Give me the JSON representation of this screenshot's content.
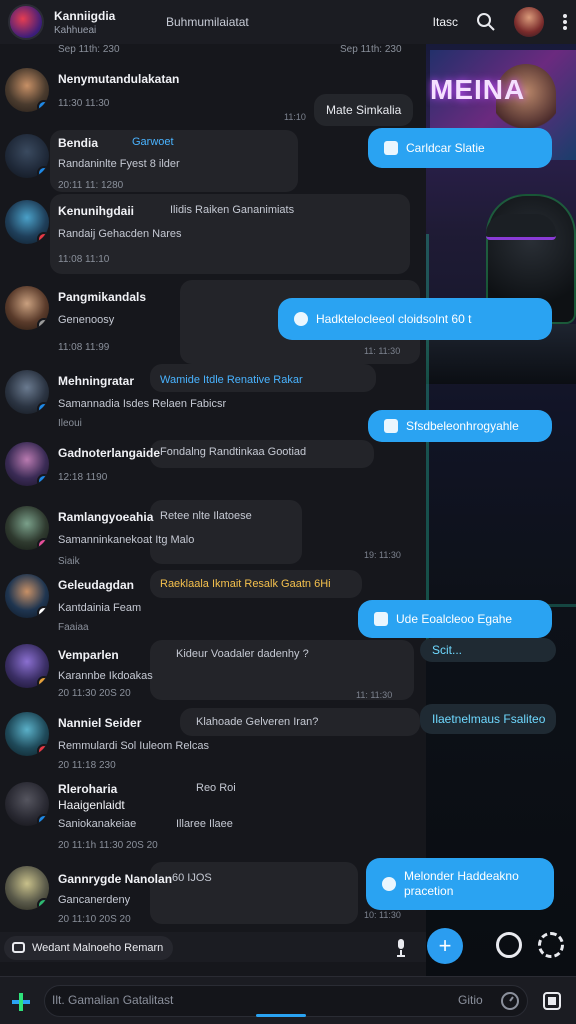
{
  "header": {
    "title": "Kanniigdia",
    "subtitle": "Kahhueai",
    "center": "Buhmumilaiatat",
    "right_label": "Itasc"
  },
  "chat": {
    "top_time_left": "Sep 11th: 230",
    "top_time_right": "Sep 11th: 230",
    "items": [
      {
        "name": "Nenymutandulakatan",
        "line": "",
        "meta": "11:30 11:30",
        "avatar_color": "#4a3b2e",
        "badge": "#1e88e5"
      },
      {
        "name": "Bendia",
        "line": "Randaninlte Fyest  8 ilder",
        "meta": "20:11 11: 1280",
        "avatar_color": "#202a3a",
        "badge": "#1e88e5"
      },
      {
        "name": "Kenunihgdaii",
        "line": "Randaij Gehacden  Nares",
        "meta": "11:08 11:10",
        "avatar_color": "#1f3f5a",
        "badge": "#e53945"
      },
      {
        "name": "Pangmikandals",
        "line": "Genenoosy",
        "meta": "11:08 11:99",
        "avatar_color": "#5a3b2b",
        "badge": "#9b9b9b"
      },
      {
        "name": "Mehningratar",
        "line": "Samannadia Isdes  Relaen  Fabicsr",
        "meta": "Ileoui",
        "avatar_color": "#2b3442",
        "badge": "#1e88e5"
      },
      {
        "name": "Gadnoterlangaide",
        "line": "",
        "meta": "12:18 1190",
        "avatar_color": "#3a2b55",
        "badge": "#1e88e5"
      },
      {
        "name": "Ramlangyoeahia",
        "line": "Samanninkanekoat  Itg  Malo",
        "meta": "Siaik",
        "avatar_color": "#2f3a2f",
        "badge": "#e54f9a"
      },
      {
        "name": "Geleudagdan",
        "line": "Kantdainia Feam",
        "meta": "Faaiaa",
        "avatar_color": "#1f3550",
        "badge": "#ffffff"
      },
      {
        "name": "Vemparlen",
        "line": "Karannbe Ikdoakas",
        "meta": "20 11:30 20S 20",
        "avatar_color": "#3b2f66",
        "badge": "#e5a03a"
      },
      {
        "name": "Nanniel  Seider",
        "line": "Remmulardi Sol  Iuleom  Relcas",
        "meta": "20 11:18 230",
        "avatar_color": "#1f4a5a",
        "badge": "#e53945"
      },
      {
        "name": "Rleroharia",
        "line": "Haaigenlaidt",
        "meta": "",
        "avatar_color": "#2a2a33",
        "badge": "#1e88e5"
      },
      {
        "name": "Saniokanakeiae",
        "line": "",
        "meta": "20 11:1h 11:30 20S 20",
        "avatar_color": "#2a2a33",
        "badge": "#1e88e5"
      },
      {
        "name": "Gannrygde Nanolan",
        "line": "Gancanerdeny",
        "meta": "20 11:10 20S 20",
        "avatar_color": "#5a5a4a",
        "badge": "#2eb872"
      }
    ],
    "inline_bubbles": {
      "b1": "Garwoet",
      "b2": "Ilidis Raiken  Gananimiats",
      "b3": "Wamide Itdle Renative Rakar",
      "b4": "Fondalng  Randtinkaa  Gootiad",
      "b5": "Retee nlte  Ilatoese",
      "b6": "Raeklaala Ikmait  Resalk Gaatn  6Hi",
      "b7": "Kideur Voadaler dadenhy ?",
      "b8": "Klahoade Gelveren Iran?",
      "b9": "Reo  Roi",
      "b10": "Illaree  Ilaee",
      "b11": "60  IJOS"
    },
    "timestamps": [
      "11:10",
      "11: 11:30",
      "19: 11:30",
      "11: 11:30",
      "10: 11:30"
    ],
    "outgoing": [
      {
        "text": "Mate Simkalia",
        "kind": "dark"
      },
      {
        "text": "Carldcar Slatie",
        "kind": "blue"
      },
      {
        "text": "Hadktelocleeol cloidsolnt 60 t",
        "kind": "blue"
      },
      {
        "text": "Sfsdbeleonhrogyahle",
        "kind": "blue"
      },
      {
        "text": "Ude Eoalcleoo Egahe",
        "kind": "blue"
      },
      {
        "text": "Scit...",
        "kind": "teal"
      },
      {
        "text": "Ilaetnelmaus Fsaliteo",
        "kind": "teal"
      },
      {
        "text": "Melonder Haddeakno pracetion",
        "kind": "blue"
      }
    ]
  },
  "wallpaper": {
    "poster_text": "MEINA"
  },
  "draft": {
    "label": "Wedant Malnoeho Remarn"
  },
  "input": {
    "placeholder": "Ilt. Gamalian Gatalitast",
    "right_label": "Gitio"
  },
  "colors": {
    "accent": "#2aa3f2",
    "bg": "#16171c"
  }
}
